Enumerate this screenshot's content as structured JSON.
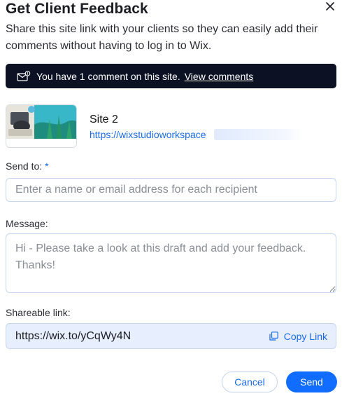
{
  "dialog": {
    "title": "Get Client Feedback",
    "subtitle": "Share this site link with your clients so they can easily add their comments without having to log in to Wix.",
    "close_icon": "close-icon"
  },
  "banner": {
    "icon": "comment-notification-icon",
    "text": "You have 1 comment on this site.",
    "link": "View comments"
  },
  "site": {
    "name": "Site 2",
    "url": "https://wixstudioworkspace"
  },
  "send_to": {
    "label": "Send to:",
    "required_mark": "*",
    "placeholder": "Enter a name or email address for each recipient"
  },
  "message": {
    "label": "Message:",
    "placeholder": "Hi - Please take a look at this draft and add your feedback. Thanks!"
  },
  "shareable": {
    "label": "Shareable link:",
    "url": "https://wix.to/yCqWy4N",
    "copy_icon": "copy-icon",
    "copy_label": "Copy Link"
  },
  "actions": {
    "cancel": "Cancel",
    "send": "Send"
  },
  "colors": {
    "accent": "#116dff",
    "banner_bg": "#0c1224",
    "share_bg": "#e7efff"
  }
}
